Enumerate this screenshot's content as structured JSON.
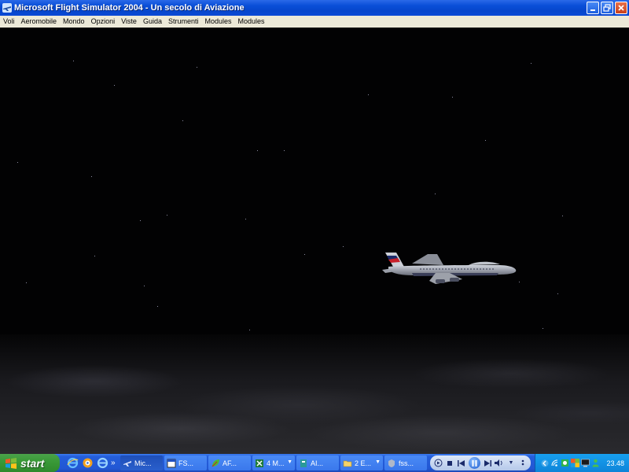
{
  "window": {
    "title": "Microsoft Flight Simulator 2004 - Un secolo di Aviazione",
    "controls": [
      "minimize",
      "restore",
      "close"
    ]
  },
  "menu": {
    "items": [
      "Voli",
      "Aeromobile",
      "Mondo",
      "Opzioni",
      "Viste",
      "Guida",
      "Strumenti",
      "Modules",
      "Modules"
    ]
  },
  "scene": {
    "description": "night sky with airliner in flight above clouds",
    "icons": [
      "aircraft-icon"
    ]
  },
  "taskbar": {
    "start_label": "start",
    "quicklaunch_more": "»",
    "tasks": [
      {
        "label": "Mic...",
        "icon": "plane-icon",
        "active": true
      },
      {
        "label": "FS...",
        "icon": "window-icon",
        "active": false
      },
      {
        "label": "AF...",
        "icon": "leaf-icon",
        "active": false
      },
      {
        "label": "4 M...",
        "icon": "excel-icon",
        "active": false,
        "group": true
      },
      {
        "label": "AI...",
        "icon": "app-icon",
        "active": false
      },
      {
        "label": "2 E...",
        "icon": "folder-icon",
        "active": false,
        "group": true
      },
      {
        "label": "fss...",
        "icon": "shield-icon",
        "active": false
      }
    ],
    "clock": "23.48"
  },
  "colors": {
    "titlebar": "#0a4fd8",
    "menubar": "#ece9d8",
    "taskbar": "#245edb",
    "start": "#3a9a38",
    "tray": "#0e84d8",
    "sky": "#020203"
  }
}
